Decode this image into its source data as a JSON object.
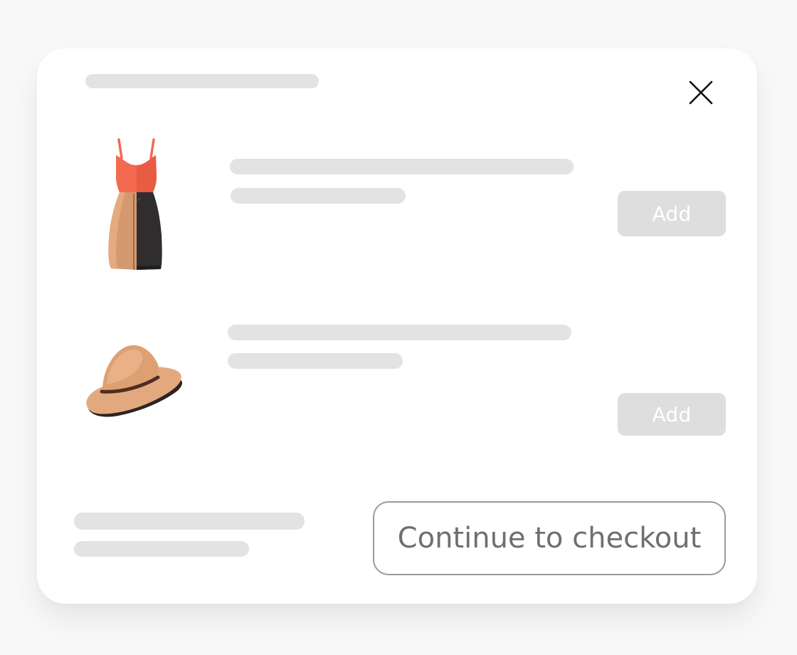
{
  "modal": {
    "close_icon": "close-icon"
  },
  "products": [
    {
      "image": "dress-icon",
      "add_label": "Add"
    },
    {
      "image": "hat-icon",
      "add_label": "Add"
    }
  ],
  "footer": {
    "checkout_label": "Continue to checkout"
  },
  "colors": {
    "page_background": "#f8f8f8",
    "modal_background": "#ffffff",
    "skeleton": "#e3e3e3",
    "add_button_background": "#dedede",
    "add_button_text": "#ffffff",
    "checkout_border": "#9a9a9a",
    "checkout_text": "#6f6f6f",
    "dress_top": "#f26a50",
    "dress_skirt_left": "#d4996f",
    "dress_skirt_right": "#2f2d2d",
    "hat": "#e3a97e",
    "hat_band": "#4e2d24"
  }
}
